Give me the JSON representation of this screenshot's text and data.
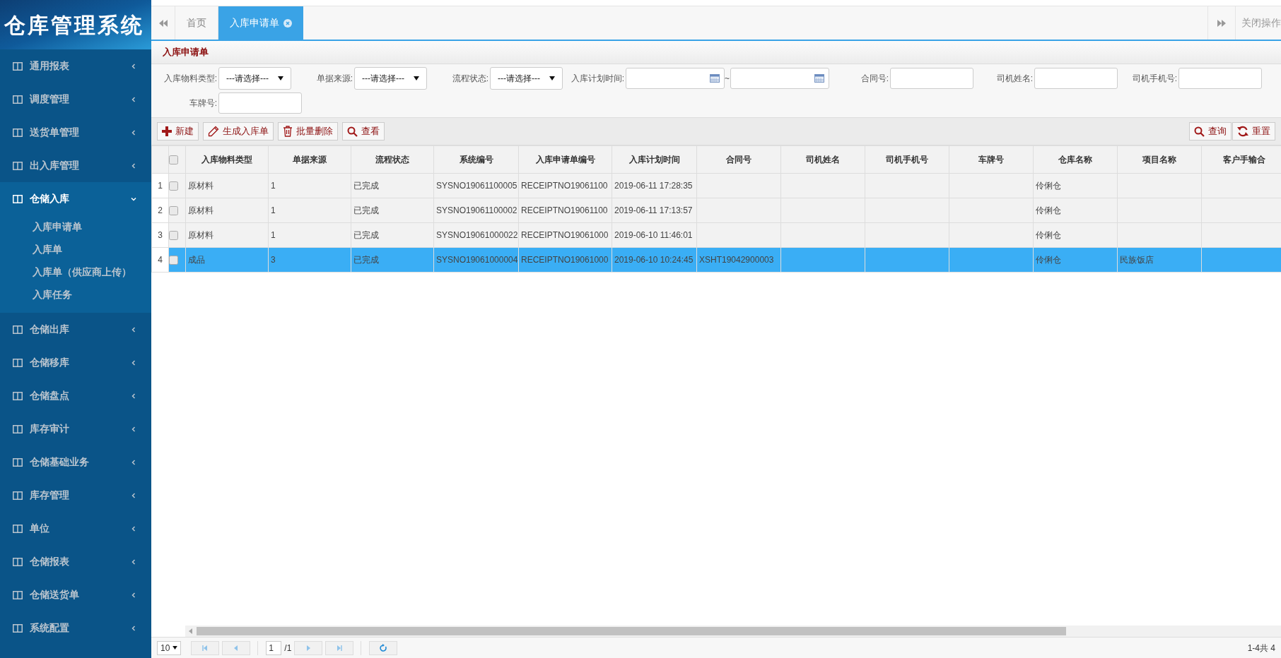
{
  "sidebar": {
    "logo_title": "仓库管理系统",
    "items": [
      {
        "label": "通用报表",
        "expanded": false
      },
      {
        "label": "调度管理",
        "expanded": false
      },
      {
        "label": "送货单管理",
        "expanded": false
      },
      {
        "label": "出入库管理",
        "expanded": false
      },
      {
        "label": "仓储入库",
        "expanded": true,
        "children": [
          {
            "label": "入库申请单"
          },
          {
            "label": "入库单"
          },
          {
            "label": "入库单（供应商上传）"
          },
          {
            "label": "入库任务"
          }
        ]
      },
      {
        "label": "仓储出库",
        "expanded": false
      },
      {
        "label": "仓储移库",
        "expanded": false
      },
      {
        "label": "仓储盘点",
        "expanded": false
      },
      {
        "label": "库存审计",
        "expanded": false
      },
      {
        "label": "仓储基础业务",
        "expanded": false
      },
      {
        "label": "库存管理",
        "expanded": false
      },
      {
        "label": "单位",
        "expanded": false
      },
      {
        "label": "仓储报表",
        "expanded": false
      },
      {
        "label": "仓储送货单",
        "expanded": false
      },
      {
        "label": "系统配置",
        "expanded": false
      }
    ]
  },
  "tabs": [
    {
      "label": "首页",
      "selected": false,
      "closable": false
    },
    {
      "label": "入库申请单",
      "selected": true,
      "closable": true
    }
  ],
  "close_menu": "关闭操作",
  "panel_title": "入库申请单",
  "filters": [
    {
      "label": "入库物料类型:",
      "kind": "select",
      "value": "---请选择---"
    },
    {
      "label": "单据来源:",
      "kind": "select",
      "value": "---请选择---"
    },
    {
      "label": "流程状态:",
      "kind": "select",
      "value": "---请选择---"
    },
    {
      "label": "入库计划时间:",
      "kind": "daterange",
      "separator": "~"
    },
    {
      "label": "合同号:",
      "kind": "text"
    },
    {
      "label": "司机姓名:",
      "kind": "text"
    },
    {
      "label": "司机手机号:",
      "kind": "text"
    },
    {
      "label": "车牌号:",
      "kind": "text"
    }
  ],
  "toolbar": [
    {
      "label": "新建",
      "kind": "add"
    },
    {
      "label": "生成入库单",
      "kind": "edit"
    },
    {
      "label": "批量删除",
      "kind": "delete"
    },
    {
      "label": "查看",
      "kind": "search"
    }
  ],
  "toolbar_right": [
    {
      "label": "查询",
      "kind": "search"
    },
    {
      "label": "重置",
      "kind": "reload"
    }
  ],
  "table": {
    "all_checked": false,
    "columns": [
      "入库物料类型",
      "单据来源",
      "流程状态",
      "系统编号",
      "入库申请单编号",
      "入库计划时间",
      "合同号",
      "司机姓名",
      "司机手机号",
      "车牌号",
      "仓库名称",
      "项目名称",
      "客户手输合"
    ],
    "rows": [
      {
        "number": "1",
        "selected": false,
        "checked": false,
        "cells": [
          "原材料",
          "1",
          "已完成",
          "SYSNO19061100005",
          "RECEIPTNO19061100",
          "2019-06-11 17:28:35",
          null,
          null,
          null,
          null,
          "伶俐仓",
          null,
          null
        ]
      },
      {
        "number": "2",
        "selected": false,
        "checked": false,
        "cells": [
          "原材料",
          "1",
          "已完成",
          "SYSNO19061100002",
          "RECEIPTNO19061100",
          "2019-06-11 17:13:57",
          null,
          null,
          null,
          null,
          "伶俐仓",
          null,
          null
        ]
      },
      {
        "number": "3",
        "selected": false,
        "checked": false,
        "cells": [
          "原材料",
          "1",
          "已完成",
          "SYSNO19061000022",
          "RECEIPTNO19061000",
          "2019-06-10 11:46:01",
          null,
          null,
          null,
          null,
          "伶俐仓",
          null,
          null
        ]
      },
      {
        "number": "4",
        "selected": true,
        "checked": false,
        "cells": [
          "成品",
          "3",
          "已完成",
          "SYSNO19061000004",
          "RECEIPTNO19061000",
          "2019-06-10 10:24:45",
          "XSHT19042900003",
          null,
          null,
          null,
          "伶俐仓",
          "民族饭店",
          null
        ]
      }
    ]
  },
  "pager": {
    "page_size": "10",
    "page": "1",
    "total_pages": "/1",
    "summary": "1-4共 4"
  }
}
